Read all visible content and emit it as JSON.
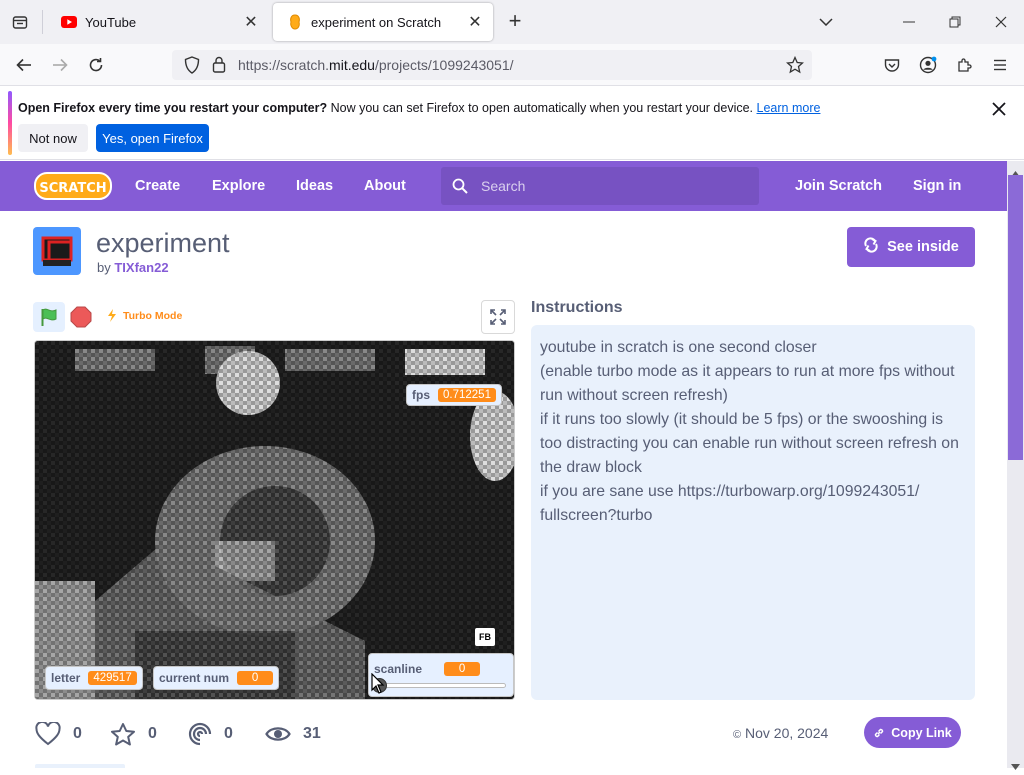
{
  "browser": {
    "tabs": [
      {
        "title": "YouTube",
        "active": false
      },
      {
        "title": "experiment on Scratch",
        "active": true
      }
    ],
    "url_prefix": "https://scratch.",
    "url_host": "mit.edu",
    "url_path": "/projects/1099243051/"
  },
  "notification": {
    "bold": "Open Firefox every time you restart your computer?",
    "text": " Now you can set Firefox to open automatically when you restart your device.",
    "link": "Learn more",
    "not_now": "Not now",
    "yes": "Yes, open Firefox"
  },
  "scratch_nav": {
    "logo": "SCRATCH",
    "links": [
      "Create",
      "Explore",
      "Ideas",
      "About"
    ],
    "search_placeholder": "Search",
    "join": "Join Scratch",
    "signin": "Sign in"
  },
  "project": {
    "title": "experiment",
    "by_label": "by",
    "author": "TIXfan22",
    "see_inside": "See inside",
    "turbo_label": "Turbo Mode"
  },
  "stage": {
    "monitors": {
      "fps_label": "fps",
      "fps_value": "0.712251",
      "letter_label": "letter",
      "letter_value": "429517",
      "current_label": "current num",
      "current_value": "0",
      "scanline_label": "scanline",
      "scanline_value": "0"
    },
    "fb_label": "FB"
  },
  "instructions": {
    "heading": "Instructions",
    "lines": [
      "youtube in scratch is one second closer",
      "(enable turbo mode as it appears to run at more fps without run without screen refresh)",
      "if it runs too slowly (it should be 5 fps) or the swooshing is too distracting you can enable run without screen refresh on the draw block",
      "if you are sane use https://turbowarp.org/1099243051/ fullscreen?turbo"
    ]
  },
  "stats": {
    "loves": "0",
    "favorites": "0",
    "remixes": "0",
    "views": "31",
    "date": "Nov 20, 2024",
    "copy_link": "Copy Link"
  },
  "colors": {
    "scratch_purple": "#855cd6",
    "firefox_blue": "#0061e0",
    "monitor_orange": "#ff8c1a"
  }
}
